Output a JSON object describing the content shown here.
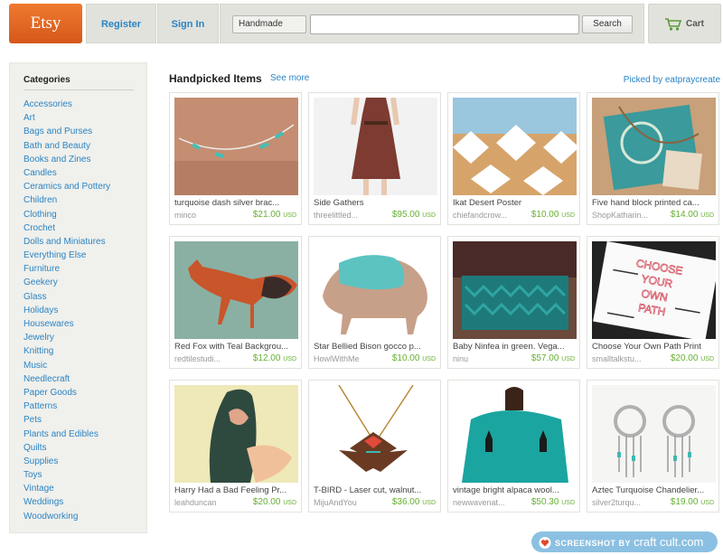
{
  "header": {
    "logo": "Etsy",
    "register": "Register",
    "sign_in": "Sign In",
    "search_category": "Handmade",
    "search_query": "",
    "search_button": "Search",
    "cart": "Cart"
  },
  "sidebar": {
    "title": "Categories",
    "categories": [
      "Accessories",
      "Art",
      "Bags and Purses",
      "Bath and Beauty",
      "Books and Zines",
      "Candles",
      "Ceramics and Pottery",
      "Children",
      "Clothing",
      "Crochet",
      "Dolls and Miniatures",
      "Everything Else",
      "Furniture",
      "Geekery",
      "Glass",
      "Holidays",
      "Housewares",
      "Jewelry",
      "Knitting",
      "Music",
      "Needlecraft",
      "Paper Goods",
      "Patterns",
      "Pets",
      "Plants and Edibles",
      "Quilts",
      "Supplies",
      "Toys",
      "Vintage",
      "Weddings",
      "Woodworking"
    ]
  },
  "main": {
    "title": "Handpicked Items",
    "see_more": "See more",
    "picked_by": "Picked by eatpraycreate",
    "items": [
      {
        "title": "turquoise dash silver brac...",
        "shop": "minco",
        "price": "$21.00",
        "currency": "USD"
      },
      {
        "title": "Side Gathers",
        "shop": "threelittled...",
        "price": "$95.00",
        "currency": "USD"
      },
      {
        "title": "Ikat Desert Poster",
        "shop": "chiefandcrow...",
        "price": "$10.00",
        "currency": "USD"
      },
      {
        "title": "Five hand block printed ca...",
        "shop": "ShopKatharin...",
        "price": "$14.00",
        "currency": "USD"
      },
      {
        "title": "Red Fox with Teal Backgrou...",
        "shop": "redtilestudi...",
        "price": "$12.00",
        "currency": "USD"
      },
      {
        "title": "Star Bellied Bison gocco p...",
        "shop": "HowlWithMe",
        "price": "$10.00",
        "currency": "USD"
      },
      {
        "title": "Baby Ninfea in green. Vega...",
        "shop": "ninu",
        "price": "$57.00",
        "currency": "USD"
      },
      {
        "title": "Choose Your Own Path Print",
        "shop": "smalltalkstu...",
        "price": "$20.00",
        "currency": "USD"
      },
      {
        "title": "Harry Had a Bad Feeling Pr...",
        "shop": "leahduncan",
        "price": "$20.00",
        "currency": "USD"
      },
      {
        "title": "T-BIRD - Laser cut, walnut...",
        "shop": "MijuAndYou",
        "price": "$36.00",
        "currency": "USD"
      },
      {
        "title": "vintage bright alpaca wool...",
        "shop": "newwavenat...",
        "price": "$50.30",
        "currency": "USD"
      },
      {
        "title": "Aztec Turquoise Chandelier...",
        "shop": "silver2turqu...",
        "price": "$19.00",
        "currency": "USD"
      }
    ],
    "image_art": {
      "print_text": [
        "CHOOSE",
        "YOUR",
        "OWN",
        "PATH"
      ]
    }
  },
  "watermark": {
    "prefix": "SCREENSHOT BY",
    "brand": "craft cult.com"
  },
  "colors": {
    "brand_orange": "#e4661e",
    "link_blue": "#2b84c4",
    "price_green": "#66b032",
    "header_gray": "#e2e2dc",
    "sidebar_bg": "#f0f0ec",
    "watermark_blue": "#8cc0e2"
  },
  "icons": {
    "cart": "shopping-cart-icon",
    "watermark": "heart-icon"
  }
}
